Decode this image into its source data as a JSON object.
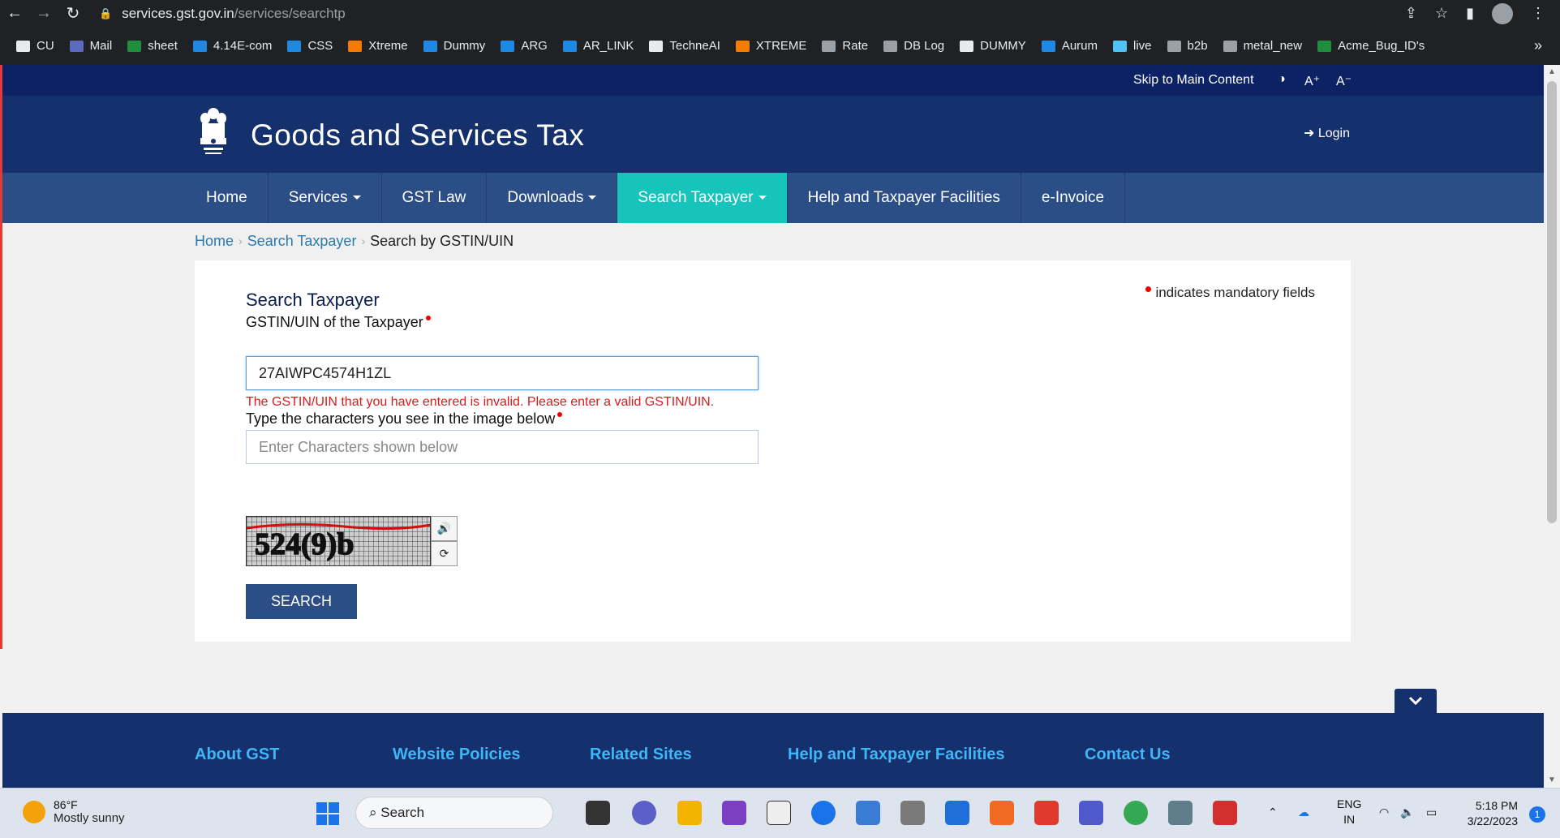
{
  "browser": {
    "url_host": "services.gst.gov.in",
    "url_path": "/services/searchtp",
    "bookmarks": [
      {
        "label": "CU",
        "color": "#e8eaed"
      },
      {
        "label": "Mail",
        "color": "#5c6bc0"
      },
      {
        "label": "sheet",
        "color": "#1e8e3e"
      },
      {
        "label": "4.14E-com",
        "color": "#1e88e5"
      },
      {
        "label": "CSS",
        "color": "#1e88e5"
      },
      {
        "label": "Xtreme",
        "color": "#f57c00"
      },
      {
        "label": "Dummy",
        "color": "#1e88e5"
      },
      {
        "label": "ARG",
        "color": "#1e88e5"
      },
      {
        "label": "AR_LINK",
        "color": "#1e88e5"
      },
      {
        "label": "TechneAI",
        "color": "#e8eaed"
      },
      {
        "label": "XTREME",
        "color": "#f57c00"
      },
      {
        "label": "Rate",
        "color": "#9aa0a6"
      },
      {
        "label": "DB Log",
        "color": "#9aa0a6"
      },
      {
        "label": "DUMMY",
        "color": "#e8eaed"
      },
      {
        "label": "Aurum",
        "color": "#1e88e5"
      },
      {
        "label": "live",
        "color": "#4fc3f7"
      },
      {
        "label": "b2b",
        "color": "#9aa0a6"
      },
      {
        "label": "metal_new",
        "color": "#9aa0a6"
      },
      {
        "label": "Acme_Bug_ID's",
        "color": "#1e8e3e"
      }
    ],
    "more": "»"
  },
  "topstrip": {
    "skip": "Skip to Main Content",
    "contrast": "◑",
    "aplus": "A⁺",
    "aminus": "A⁻"
  },
  "header": {
    "title": "Goods and Services Tax",
    "login": "Login"
  },
  "nav": {
    "items": [
      {
        "label": "Home"
      },
      {
        "label": "Services"
      },
      {
        "label": "GST Law"
      },
      {
        "label": "Downloads"
      },
      {
        "label": "Search Taxpayer"
      },
      {
        "label": "Help and Taxpayer Facilities"
      },
      {
        "label": "e-Invoice"
      }
    ]
  },
  "breadcrumb": {
    "home": "Home",
    "search_taxpayer": "Search Taxpayer",
    "current": "Search by GSTIN/UIN"
  },
  "form": {
    "title": "Search Taxpayer",
    "mandatory_note": "indicates mandatory fields",
    "gstin_label": "GSTIN/UIN of the Taxpayer",
    "gstin_value": "27AIWPC4574H1ZL",
    "error": "The GSTIN/UIN that you have entered is invalid. Please enter a valid GSTIN/UIN.",
    "captcha_label": "Type the characters you see in the image below",
    "captcha_placeholder": "Enter Characters shown below",
    "captcha_text": "524(9)b",
    "search_button": "SEARCH"
  },
  "footer": {
    "sections": [
      {
        "label": "About GST"
      },
      {
        "label": "Website Policies"
      },
      {
        "label": "Related Sites"
      },
      {
        "label": "Help and Taxpayer Facilities"
      },
      {
        "label": "Contact Us"
      }
    ]
  },
  "taskbar": {
    "temp": "86°F",
    "weather": "Mostly sunny",
    "search": "Search",
    "lang1": "ENG",
    "lang2": "IN",
    "time": "5:18 PM",
    "date": "3/22/2023",
    "notifications": "1"
  },
  "colors": {
    "header": "#14306d",
    "nav": "#2c4e86",
    "active_tab": "#17c4bb",
    "error": "#d81c1c"
  }
}
